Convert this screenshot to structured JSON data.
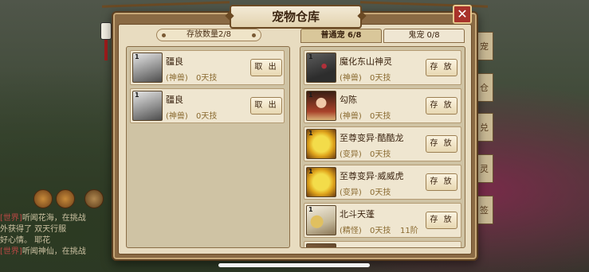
{
  "dialog": {
    "title": "宠物仓库",
    "close_label": "✕"
  },
  "storage": {
    "header": "存放数量2/8",
    "take_label": "取 出",
    "items": [
      {
        "name": "疆良",
        "type": "(神兽)",
        "skills": "0天技",
        "level": "1"
      },
      {
        "name": "疆良",
        "type": "(神兽)",
        "skills": "0天技",
        "level": "1"
      }
    ]
  },
  "tabs": [
    {
      "label": "普通宠  6/8",
      "active": true
    },
    {
      "label": "鬼宠  0/8",
      "active": false
    }
  ],
  "pets": {
    "store_label": "存 放",
    "items": [
      {
        "name": "魔化东山神灵",
        "type": "(神兽)",
        "skills": "0天技",
        "stage": "",
        "level": "1",
        "icon": "ico-dragon"
      },
      {
        "name": "勾陈",
        "type": "(神兽)",
        "skills": "0天技",
        "stage": "",
        "level": "1",
        "icon": "ico-goucheng"
      },
      {
        "name": "至尊变异·酷酷龙",
        "type": "(变异)",
        "skills": "0天技",
        "stage": "",
        "level": "1",
        "icon": "ico-yellow"
      },
      {
        "name": "至尊变异·威威虎",
        "type": "(变异)",
        "skills": "0天技",
        "stage": "",
        "level": "1",
        "icon": "ico-yellow"
      },
      {
        "name": "北斗天蓬",
        "type": "(精怪)",
        "skills": "0天技",
        "stage": "11阶",
        "level": "1",
        "icon": "ico-beidou"
      }
    ]
  },
  "background": {
    "side_tabs": [
      "宠",
      "仓",
      "兑",
      "灵",
      "签"
    ],
    "chat_lines": [
      {
        "prefix": "[世界]",
        "text": "听闻花海，在挑战"
      },
      {
        "prefix": "",
        "text": "外获得了 双天行服"
      },
      {
        "prefix": "",
        "text": "好心情。 耶花"
      },
      {
        "prefix": "[世界]",
        "text": "听闻神仙，在挑战"
      }
    ]
  }
}
